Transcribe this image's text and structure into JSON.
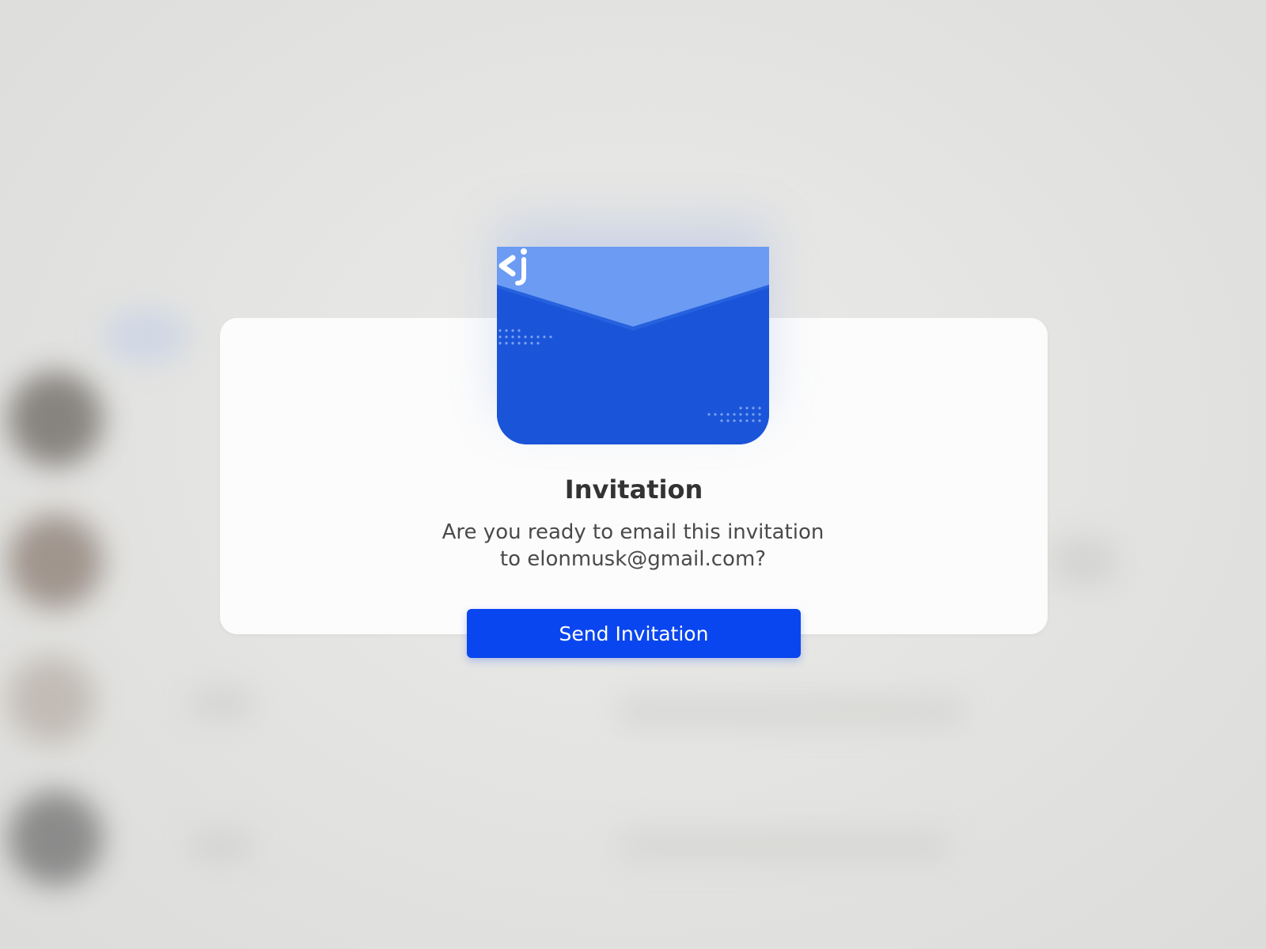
{
  "dialog": {
    "title": "Invitation",
    "message_line1": "Are you ready to email this invitation",
    "message_line2": "to elonmusk@gmail.com?",
    "send_label": "Send Invitation"
  },
  "icons": {
    "envelope": "envelope-icon",
    "logo": "brand-logo-icon"
  },
  "colors": {
    "envelope_body": "#1a55d9",
    "envelope_flap": "#6b9bf3",
    "button": "#0a46ef",
    "title": "#333333",
    "message": "#4a4a4a"
  }
}
